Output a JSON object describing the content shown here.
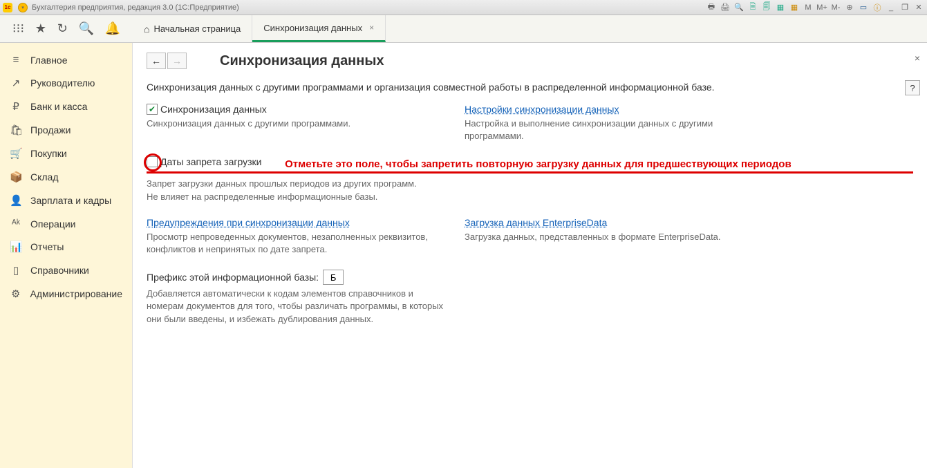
{
  "titlebar": {
    "title": "Бухгалтерия предприятия, редакция 3.0  (1С:Предприятие)"
  },
  "topbar_icons": {
    "m": "M",
    "mplus": "M+",
    "mminus": "M-"
  },
  "tabs": [
    {
      "label": "Начальная страница",
      "home": true
    },
    {
      "label": "Синхронизация данных",
      "active": true,
      "closable": true
    }
  ],
  "sidebar": [
    {
      "icon": "≡",
      "label": "Главное"
    },
    {
      "icon": "↗",
      "label": "Руководителю"
    },
    {
      "icon": "₽",
      "label": "Банк и касса"
    },
    {
      "icon": "🛍",
      "label": "Продажи"
    },
    {
      "icon": "🛒",
      "label": "Покупки"
    },
    {
      "icon": "📦",
      "label": "Склад"
    },
    {
      "icon": "👤",
      "label": "Зарплата и кадры"
    },
    {
      "icon": "ᴬᵏ",
      "label": "Операции"
    },
    {
      "icon": "📊",
      "label": "Отчеты"
    },
    {
      "icon": "▯",
      "label": "Справочники"
    },
    {
      "icon": "⚙",
      "label": "Администрирование"
    }
  ],
  "page": {
    "title": "Синхронизация данных",
    "intro": "Синхронизация данных с другими программами и организация совместной работы в распределенной информационной базе.",
    "sync_chk_label": "Синхронизация данных",
    "sync_chk_desc": "Синхронизация данных с другими программами.",
    "sync_settings_link": "Настройки синхронизации данных",
    "sync_settings_desc": "Настройка и выполнение синхронизации данных с другими программами.",
    "dates_chk_label": "Даты запрета загрузки",
    "annotation": "Отметьте это поле, чтобы запретить повторную загрузку данных для предшествующих периодов",
    "dates_desc": "Запрет загрузки данных прошлых периодов из других программ.\nНе влияет на распределенные информационные базы.",
    "warnings_link": "Предупреждения при синхронизации данных",
    "warnings_desc": "Просмотр непроведенных документов, незаполненных реквизитов, конфликтов и непринятых по дате запрета.",
    "load_link": "Загрузка данных EnterpriseData",
    "load_desc": "Загрузка данных, представленных в формате EnterpriseData.",
    "prefix_label": "Префикс этой информационной базы:",
    "prefix_value": "Б",
    "prefix_desc": "Добавляется автоматически к кодам элементов справочников и номерам документов для того, чтобы различать программы, в которых они были введены, и избежать дублирования данных.",
    "help": "?"
  }
}
